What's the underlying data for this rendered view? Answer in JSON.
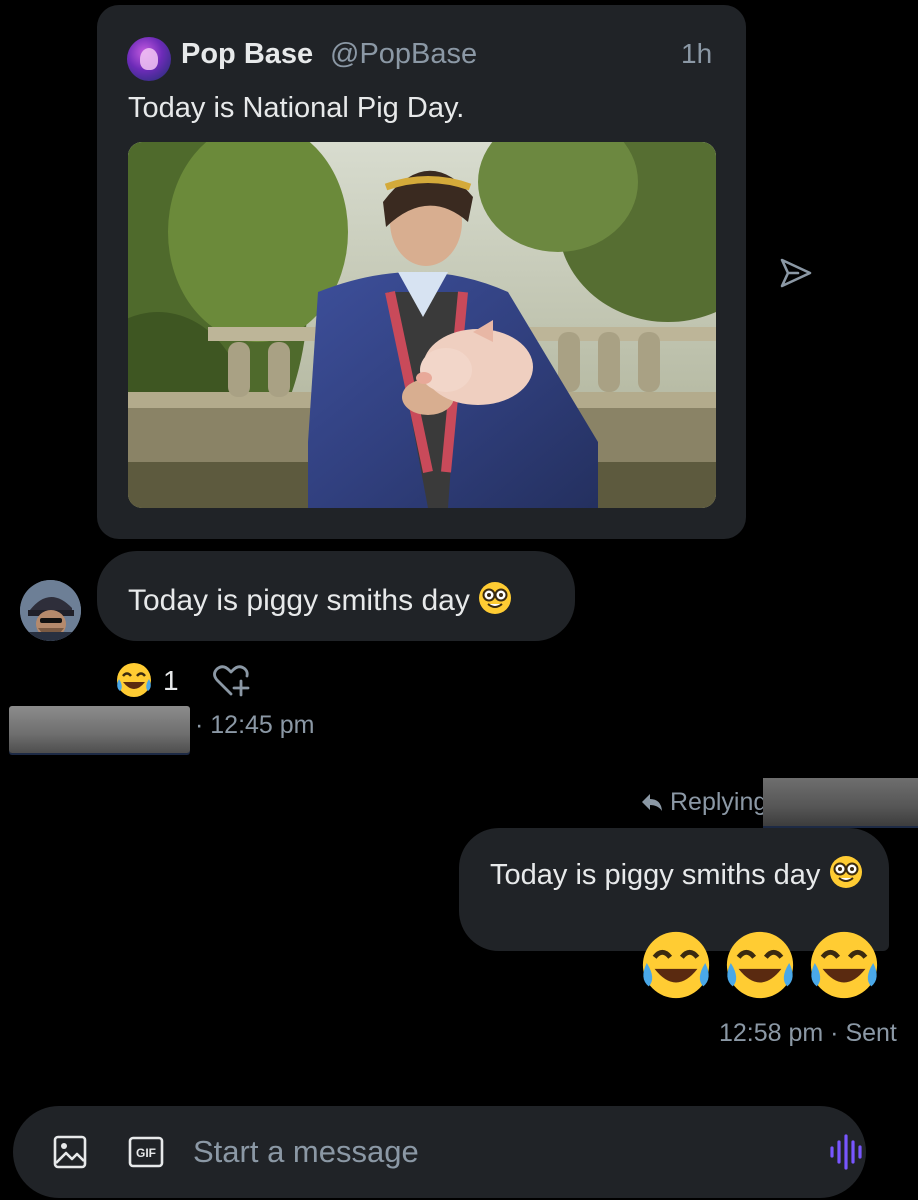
{
  "quoted_tweet": {
    "author_name": "Pop Base",
    "author_handle": "@PopBase",
    "time": "1h",
    "text": "Today is National Pig Day.",
    "avatar_icon": "pop-base-avatar",
    "photo": "man-holding-piglet-photo"
  },
  "received_message": {
    "text": "Today is piggy smiths day",
    "emoji": "nerd-face-emoji",
    "reaction": {
      "emoji": "face-with-tears-of-joy",
      "count": "1"
    },
    "time": "· 12:45 pm"
  },
  "sent_message": {
    "replying_label": "Replying",
    "text": "Today is piggy smiths day",
    "emoji": "nerd-face-emoji",
    "big_emojis": [
      "face-with-tears-of-joy",
      "face-with-tears-of-joy",
      "face-with-tears-of-joy"
    ],
    "status": "12:58 pm · Sent"
  },
  "composer": {
    "placeholder": "Start a message",
    "gif_label": "GIF"
  },
  "colors": {
    "background": "#000000",
    "bubble": "#202327",
    "muted_text": "#8b98a5",
    "voice_accent": "#7856ff"
  }
}
